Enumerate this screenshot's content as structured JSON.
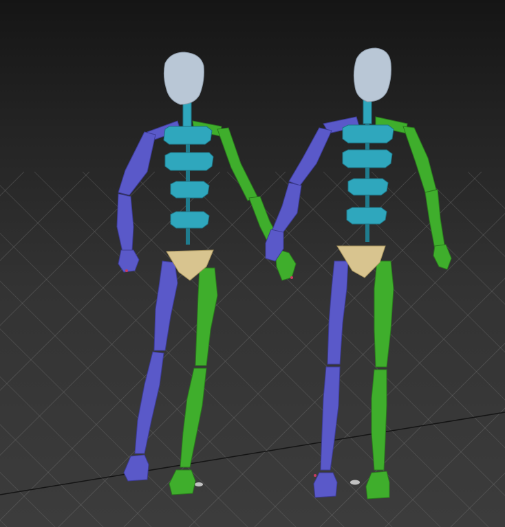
{
  "viewport": {
    "background_top": "#151515",
    "background_bottom": "#3c3c3c",
    "grid_color": "#7a7a7a",
    "grid_axis_color": "#111111"
  },
  "colors": {
    "head": "#b9c7d6",
    "spine": "#2fa7bd",
    "pelvis": "#d8c48f",
    "left_limbs": "#5a59c9",
    "right_limbs": "#3fae2c",
    "ground_marker": "#d9d9d9",
    "joint_marker": "#c83b62"
  },
  "scene": {
    "object_type": "biped",
    "objects": [
      "biped-a",
      "biped-b"
    ]
  }
}
